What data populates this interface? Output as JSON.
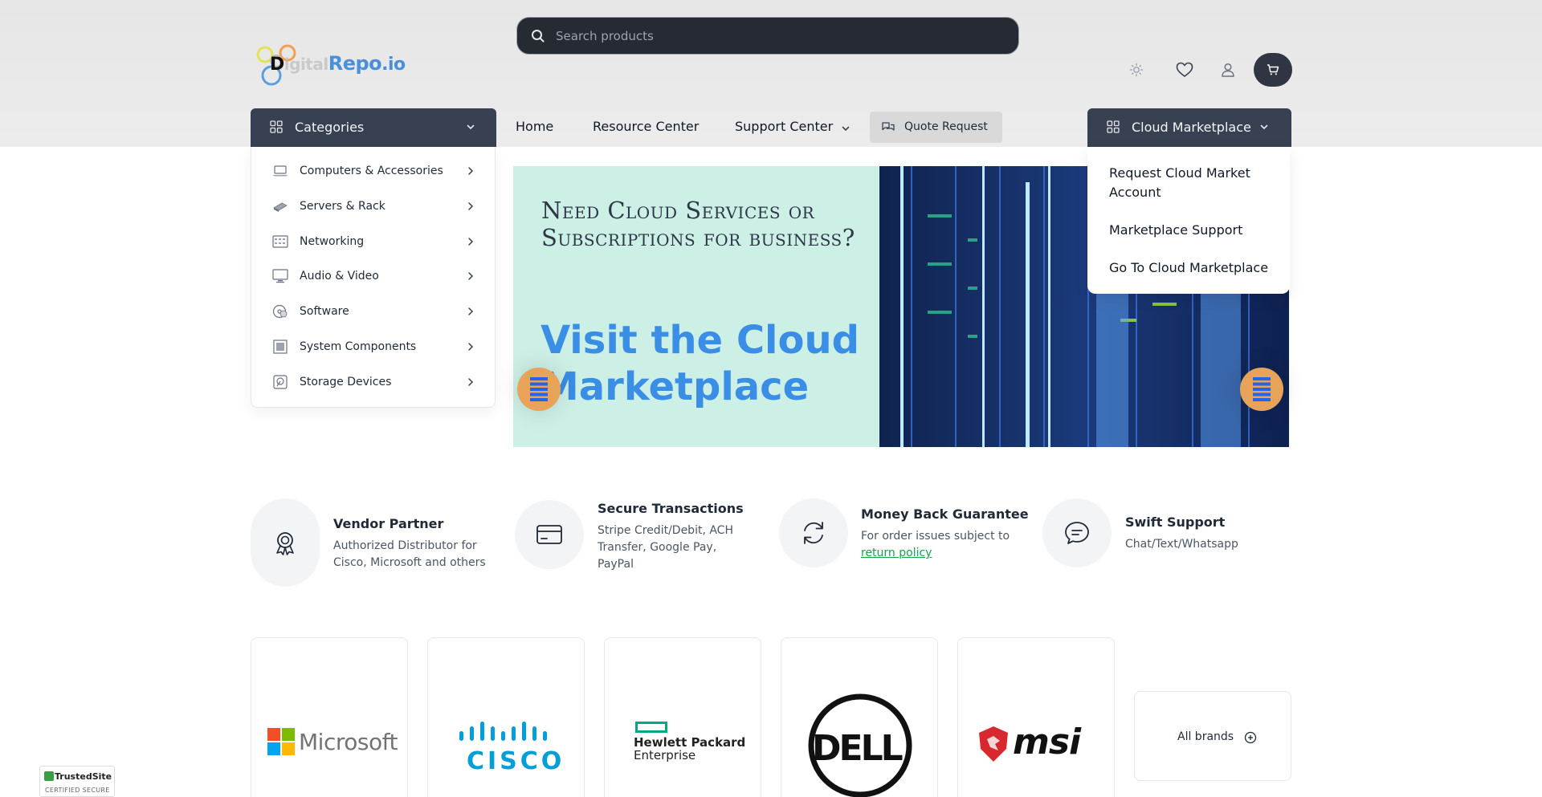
{
  "header": {
    "logo_text": {
      "d": "D",
      "igital": "igital",
      "repo": "Repo",
      "io": ".io"
    },
    "search_placeholder": "Search products"
  },
  "nav": {
    "categories_label": "Categories",
    "links": [
      "Home",
      "Resource Center",
      "Support Center"
    ],
    "quote_label": "Quote Request",
    "cloud_label": "Cloud Marketplace"
  },
  "categories": [
    {
      "label": "Computers & Accessories",
      "icon": "laptop-icon"
    },
    {
      "label": "Servers & Rack",
      "icon": "server-icon"
    },
    {
      "label": "Networking",
      "icon": "network-switch-icon"
    },
    {
      "label": "Audio & Video",
      "icon": "monitor-icon"
    },
    {
      "label": "Software",
      "icon": "software-disc-icon"
    },
    {
      "label": "System Components",
      "icon": "chip-icon"
    },
    {
      "label": "Storage Devices",
      "icon": "hard-drive-icon"
    }
  ],
  "cloud_menu": [
    "Request Cloud Market Account",
    "Marketplace Support",
    "Go To Cloud Marketplace"
  ],
  "banner": {
    "title": "Need Cloud Services or Subscriptions for business?",
    "cta": "Visit the Cloud Marketplace"
  },
  "features": [
    {
      "title": "Vendor Partner",
      "desc": "Authorized Distributor for Cisco, Microsoft and others",
      "icon": "award-icon"
    },
    {
      "title": "Secure Transactions",
      "desc": "Stripe Credit/Debit, ACH Transfer, Google Pay, PayPal",
      "icon": "credit-card-icon"
    },
    {
      "title": "Money Back Guarantee",
      "desc": "For order issues subject to",
      "link": "return policy",
      "icon": "refresh-icon"
    },
    {
      "title": "Swift Support",
      "desc": "Chat/Text/Whatsapp",
      "icon": "chat-icon"
    }
  ],
  "brands": {
    "microsoft": "Microsoft",
    "cisco": "CISCO",
    "hpe_line1": "Hewlett Packard",
    "hpe_line2": "Enterprise",
    "dell": "DELL",
    "msi": "msi",
    "all_brands_label": "All brands"
  },
  "trusted": {
    "title": "TrustedSite",
    "subtitle": "CERTIFIED SECURE"
  },
  "colors": {
    "nav_dark": "#374151",
    "search_bg": "#262a33",
    "accent_blue": "#3a8ee6",
    "link_green": "#16a34a",
    "slider_orange": "#e8a35a"
  }
}
